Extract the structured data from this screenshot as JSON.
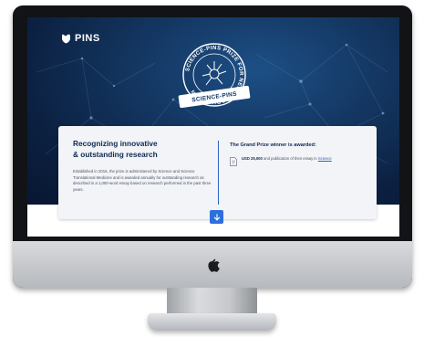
{
  "brand": {
    "name": "PINS",
    "icon": "pins-logo-icon"
  },
  "seal": {
    "arc_text": "SCIENCE-PINS PRIZE FOR NEUROMODULATION",
    "banner_text": "SCIENCE-PINS"
  },
  "card": {
    "headline_line1": "Recognizing innovative",
    "headline_line2": "& outstanding research",
    "description": "Established in 2016, the prize is administered by Science and Science Translational Medicine and is awarded annually for outstanding research as described in a 1,000-word essay based on research performed in the past three years.",
    "prize_heading": "The Grand Prize winner is awarded:",
    "prize_amount": "USD 25,000",
    "prize_text": " and publication of their essay in ",
    "prize_link": "Science",
    "prize_icon": "document-icon"
  },
  "scroll": {
    "icon": "arrow-down-icon"
  },
  "colors": {
    "hero_dark": "#0b1f3f",
    "hero_light": "#1d4f86",
    "accent": "#2f6fdc",
    "heading": "#0f2952",
    "card_bg": "#f2f4f7"
  }
}
